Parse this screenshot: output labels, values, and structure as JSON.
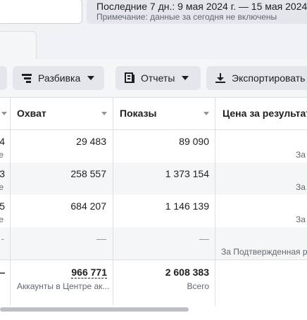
{
  "date_range": {
    "label": "Последние 7 дн.: 9 мая 2024 г. — 15 мая 2024 г.",
    "note": "Примечание: данные за сегодня не включены"
  },
  "toolbar": {
    "breakdown_label": "Разбивка",
    "reports_label": "Отчеты",
    "export_label": "Экспортировать"
  },
  "columns": {
    "reach": "Охват",
    "impressions": "Показы",
    "cost_per_result": "Цена за результат"
  },
  "rows": [
    {
      "left_value": "4",
      "left_sub": "е",
      "reach": "29 483",
      "impressions": "89 090",
      "cost_sub": "За"
    },
    {
      "left_value": "3",
      "left_sub": "е",
      "reach": "258 557",
      "impressions": "1 373 154",
      "cost_sub": "За"
    },
    {
      "left_value": "5",
      "left_sub": "е",
      "reach": "684 207",
      "impressions": "1 146 139",
      "cost_sub": "За"
    },
    {
      "left_value": "-",
      "left_sub": "",
      "reach": "—",
      "impressions": "—",
      "cost_sub": "За Подтвержденная р"
    }
  ],
  "totals": {
    "left_value": "—",
    "reach": "966 771",
    "reach_sub": "Аккаунты в Центре ак...",
    "impressions": "2 608 383",
    "impressions_sub": "Всего"
  },
  "colors": {
    "row_alt": "#f5f6f7",
    "border": "#dddfe2",
    "button": "#e4e6eb"
  }
}
